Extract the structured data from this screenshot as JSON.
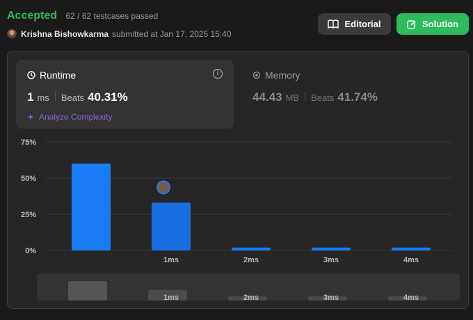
{
  "header": {
    "status": "Accepted",
    "testcases": "62 / 62 testcases passed",
    "user": "Krishna Bishowkarma",
    "submitted": "submitted at Jan 17, 2025 15:40"
  },
  "buttons": {
    "editorial": "Editorial",
    "solution": "Solution"
  },
  "runtime": {
    "title": "Runtime",
    "value": "1",
    "unit": "ms",
    "beats_label": "Beats",
    "beats_value": "40.31%",
    "analyze": "Analyze Complexity"
  },
  "memory": {
    "title": "Memory",
    "value": "44.43",
    "unit": "MB",
    "beats_label": "Beats",
    "beats_value": "41.74%"
  },
  "colors": {
    "accent_green": "#2cbb5d",
    "bar_blue": "#1a7cf5",
    "purple": "#8a63d2"
  },
  "chart_data": {
    "type": "bar",
    "categories": [
      "",
      "1ms",
      "2ms",
      "3ms",
      "4ms"
    ],
    "values": [
      60,
      33,
      2,
      2,
      2
    ],
    "ylim": [
      0,
      75
    ],
    "yticks": [
      "0%",
      "25%",
      "50%",
      "75%"
    ],
    "grid": true,
    "highlighted_category": "1ms",
    "overview_labels": [
      "",
      "1ms",
      "2ms",
      "3ms",
      "4ms"
    ]
  }
}
